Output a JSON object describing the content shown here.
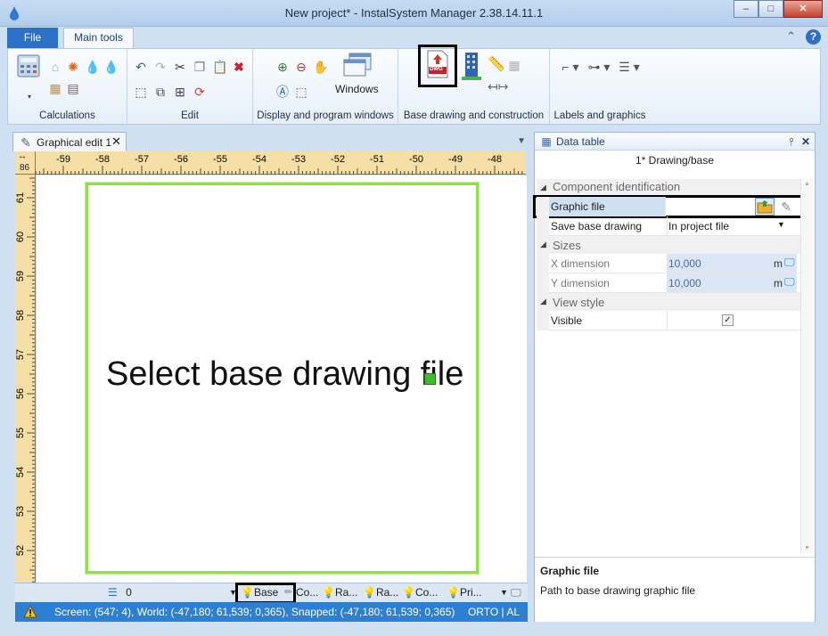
{
  "window": {
    "title": "New project* - InstalSystem Manager 2.38.14.11.1",
    "minimize": "‒",
    "maximize": "□",
    "close": "✕"
  },
  "ribbon_tabs": {
    "file": "File",
    "main_tools": "Main tools",
    "collapse": "⌃",
    "help": "?"
  },
  "ribbon_groups": {
    "calculations": "Calculations",
    "edit": "Edit",
    "display": "Display and program windows",
    "windows_button": "Windows",
    "base_drawing": "Base drawing and construction",
    "dwg_label": "DWG",
    "labels": "Labels and graphics"
  },
  "document_tab": {
    "label": "Graphical edit 1",
    "close": "✕"
  },
  "ruler": {
    "corner_value": "86",
    "top_ticks": [
      "-59",
      "-58",
      "-57",
      "-56",
      "-55",
      "-54",
      "-53",
      "-52",
      "-51",
      "-50",
      "-49",
      "-48"
    ],
    "left_ticks": [
      "61",
      "60",
      "59",
      "58",
      "57",
      "56",
      "55",
      "54",
      "53",
      "52"
    ]
  },
  "canvas": {
    "message": "Select base drawing file"
  },
  "layer_bar": {
    "current_layer": "0",
    "tabs": [
      "Base",
      "Co...",
      "Ra...",
      "Ra...",
      "Co...",
      "Pri..."
    ]
  },
  "status": {
    "coordinates": "Screen: (547; 4), World: (-47,180; 61,539; 0,365), Snapped: (-47,180; 61,539; 0,365)",
    "modes": "ORTO | AL"
  },
  "data_table": {
    "title": "Data table",
    "pin": "⫯",
    "close": "✕",
    "object": "1* Drawing/base",
    "categories": {
      "identification": "Component identification",
      "sizes": "Sizes",
      "view_style": "View style"
    },
    "graphic_file_label": "Graphic file",
    "save_base_label": "Save base drawing",
    "save_base_value": "In project file",
    "x_label": "X dimension",
    "x_value": "10,000",
    "x_unit": "m",
    "y_label": "Y dimension",
    "y_value": "10,000",
    "y_unit": "m",
    "visible_label": "Visible",
    "visible_check": "✓",
    "description_title": "Graphic file",
    "description_text": "Path to base drawing graphic file"
  }
}
